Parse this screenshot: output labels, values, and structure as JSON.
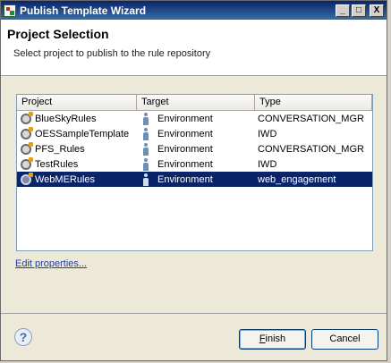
{
  "window": {
    "title": "Publish Template Wizard",
    "controls": [
      "_",
      "□",
      "X"
    ]
  },
  "header": {
    "title": "Project Selection",
    "subtitle": "Select project to publish to the rule repository"
  },
  "table": {
    "columns": [
      "Project",
      "Target",
      "Type"
    ],
    "rows": [
      {
        "project": "BlueSkyRules",
        "target": "Environment",
        "type": "CONVERSATION_MGR",
        "selected": false
      },
      {
        "project": "OESSampleTemplate",
        "target": "Environment",
        "type": "IWD",
        "selected": false
      },
      {
        "project": "PFS_Rules",
        "target": "Environment",
        "type": "CONVERSATION_MGR",
        "selected": false
      },
      {
        "project": "TestRules",
        "target": "Environment",
        "type": "IWD",
        "selected": false
      },
      {
        "project": "WebMERules",
        "target": "Environment",
        "type": "web_engagement",
        "selected": true
      }
    ]
  },
  "links": {
    "edit_properties": "Edit properties..."
  },
  "footer": {
    "help_label": "?",
    "finish_first": "F",
    "finish_rest": "inish",
    "cancel": "Cancel"
  },
  "colors": {
    "selection": "#0a246a",
    "titlebar": "#0a246a",
    "link": "#1f3fa6"
  },
  "icons": {
    "project": "project-gear-icon",
    "target": "person-icon",
    "help": "help-icon"
  }
}
